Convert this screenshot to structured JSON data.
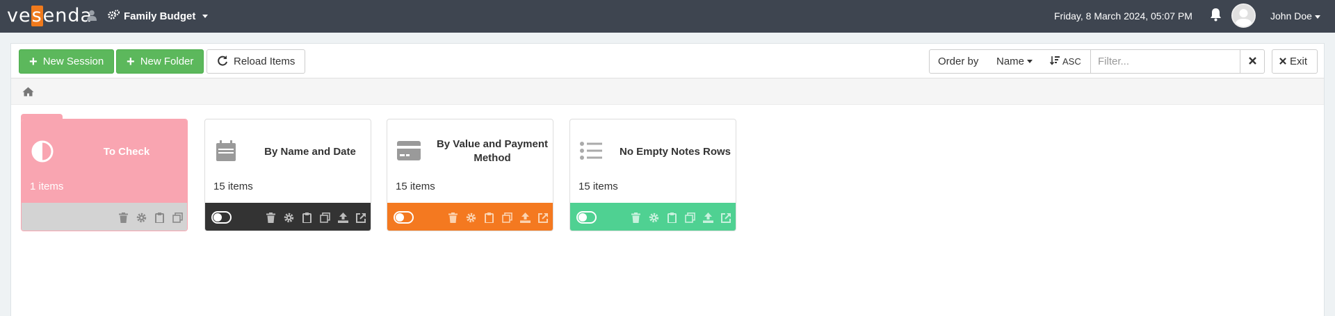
{
  "header": {
    "logo_text_1": "ve",
    "logo_text_2": "s",
    "logo_text_3": "enda",
    "app_name": "Family Budget",
    "datetime": "Friday, 8 March 2024, 05:07 PM",
    "user_name": "John Doe"
  },
  "toolbar": {
    "new_session_label": "New Session",
    "new_folder_label": "New Folder",
    "reload_label": "Reload Items",
    "order_by_label": "Order by",
    "order_field": "Name",
    "order_dir": "ASC",
    "filter_placeholder": "Filter...",
    "exit_label": "Exit"
  },
  "cards": [
    {
      "title": "To Check",
      "count": "1 items",
      "type": "folder",
      "color": "#f9a5b1",
      "footer_color": "#d3d3d3"
    },
    {
      "title": "By Name and Date",
      "count": "15 items",
      "type": "session",
      "color": "#ffffff",
      "footer_color": "#333333"
    },
    {
      "title": "By Value and Payment Method",
      "count": "15 items",
      "type": "session",
      "color": "#ffffff",
      "footer_color": "#f47920"
    },
    {
      "title": "No Empty Notes Rows",
      "count": "15 items",
      "type": "session",
      "color": "#ffffff",
      "footer_color": "#4fd192"
    }
  ],
  "colors": {
    "topbar": "#3e4550",
    "accent": "#f07a1c",
    "green_button": "#5cb85c"
  },
  "icons": [
    "user-icon",
    "gears-icon",
    "bell-icon",
    "home-icon",
    "refresh-icon",
    "sort-icon",
    "close-icon",
    "half-circle-icon",
    "calendar-icon",
    "credit-card-icon",
    "list-icon",
    "trash-icon",
    "gear-icon",
    "clipboard-icon",
    "copy-icon",
    "upload-icon",
    "external-link-icon"
  ]
}
